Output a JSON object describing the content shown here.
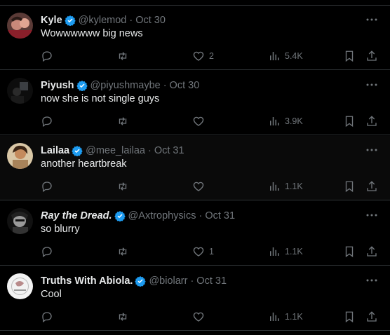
{
  "posts": [
    {
      "name": "Kyle",
      "handle": "@kylemod",
      "date": "Oct 30",
      "text": "Wowwwwww big news",
      "likes": "2",
      "views": "5.4K",
      "avatar": "kyle-avatar",
      "italic": false
    },
    {
      "name": "Piyush",
      "handle": "@piyushmaybe",
      "date": "Oct 30",
      "text": "now she is not single guys",
      "likes": "",
      "views": "3.9K",
      "avatar": "piyush-avatar",
      "italic": false
    },
    {
      "name": "Lailaa",
      "handle": "@mee_lailaa",
      "date": "Oct 31",
      "text": "another heartbreak",
      "likes": "",
      "views": "1.1K",
      "avatar": "lailaa-avatar",
      "italic": false
    },
    {
      "name": "Ray the Dread.",
      "handle": "@Axtrophysics",
      "date": "Oct 31",
      "text": "so blurry",
      "likes": "1",
      "views": "1.1K",
      "avatar": "ray-avatar",
      "italic": true
    },
    {
      "name": "Truths With Abiola.",
      "handle": "@biolarr",
      "date": "Oct 31",
      "text": "Cool",
      "likes": "",
      "views": "1.1K",
      "avatar": "abiola-avatar",
      "italic": false
    }
  ],
  "separator": "·",
  "colors": {
    "background": "#000000",
    "text": "#e7e9ea",
    "muted": "#71767b",
    "verified": "#1d9bf0",
    "border": "#2f3336"
  }
}
